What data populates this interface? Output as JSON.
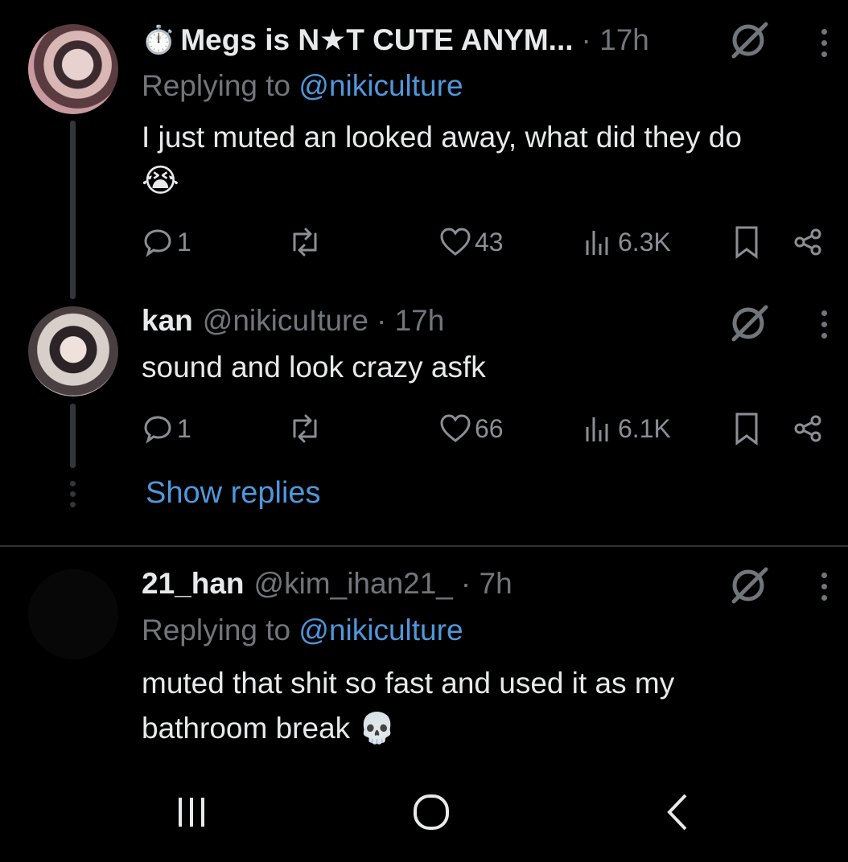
{
  "tweets": [
    {
      "display_name": "Megs is N★T CUTE ANYM...",
      "name_prefix_emoji": "⏱️",
      "time": "· 17h",
      "replying_label": "Replying to",
      "replying_handle": "@nikiculture",
      "text": "I just muted an looked away, what did they do",
      "text_emoji": "😭",
      "replies": "1",
      "likes": "43",
      "views": "6.3K"
    },
    {
      "display_name": "kan",
      "handle": "@nikicuIture",
      "time": "· 17h",
      "text": "sound and look crazy asfk",
      "replies": "1",
      "likes": "66",
      "views": "6.1K"
    },
    {
      "display_name": "21_han",
      "handle": "@kim_ihan21_",
      "time": "· 7h",
      "replying_label": "Replying to",
      "replying_handle": "@nikiculture",
      "text_line1": "muted that shit so fast and used it as my",
      "text_line2": "bathroom break",
      "text_emoji": "💀"
    }
  ],
  "show_replies_label": "Show replies",
  "icons": {
    "reply": "reply-icon",
    "retweet": "retweet-icon",
    "like": "heart-icon",
    "views": "views-icon",
    "bookmark": "bookmark-icon",
    "share": "share-icon",
    "grok": "grok-icon",
    "more": "more-icon"
  },
  "colors": {
    "background": "#000000",
    "text": "#e7e9ea",
    "muted": "#71767b",
    "link": "#4f97dc",
    "divider": "#2f3336"
  },
  "navbar": {
    "recents": "recents-icon",
    "home": "home-icon",
    "back": "back-icon"
  }
}
